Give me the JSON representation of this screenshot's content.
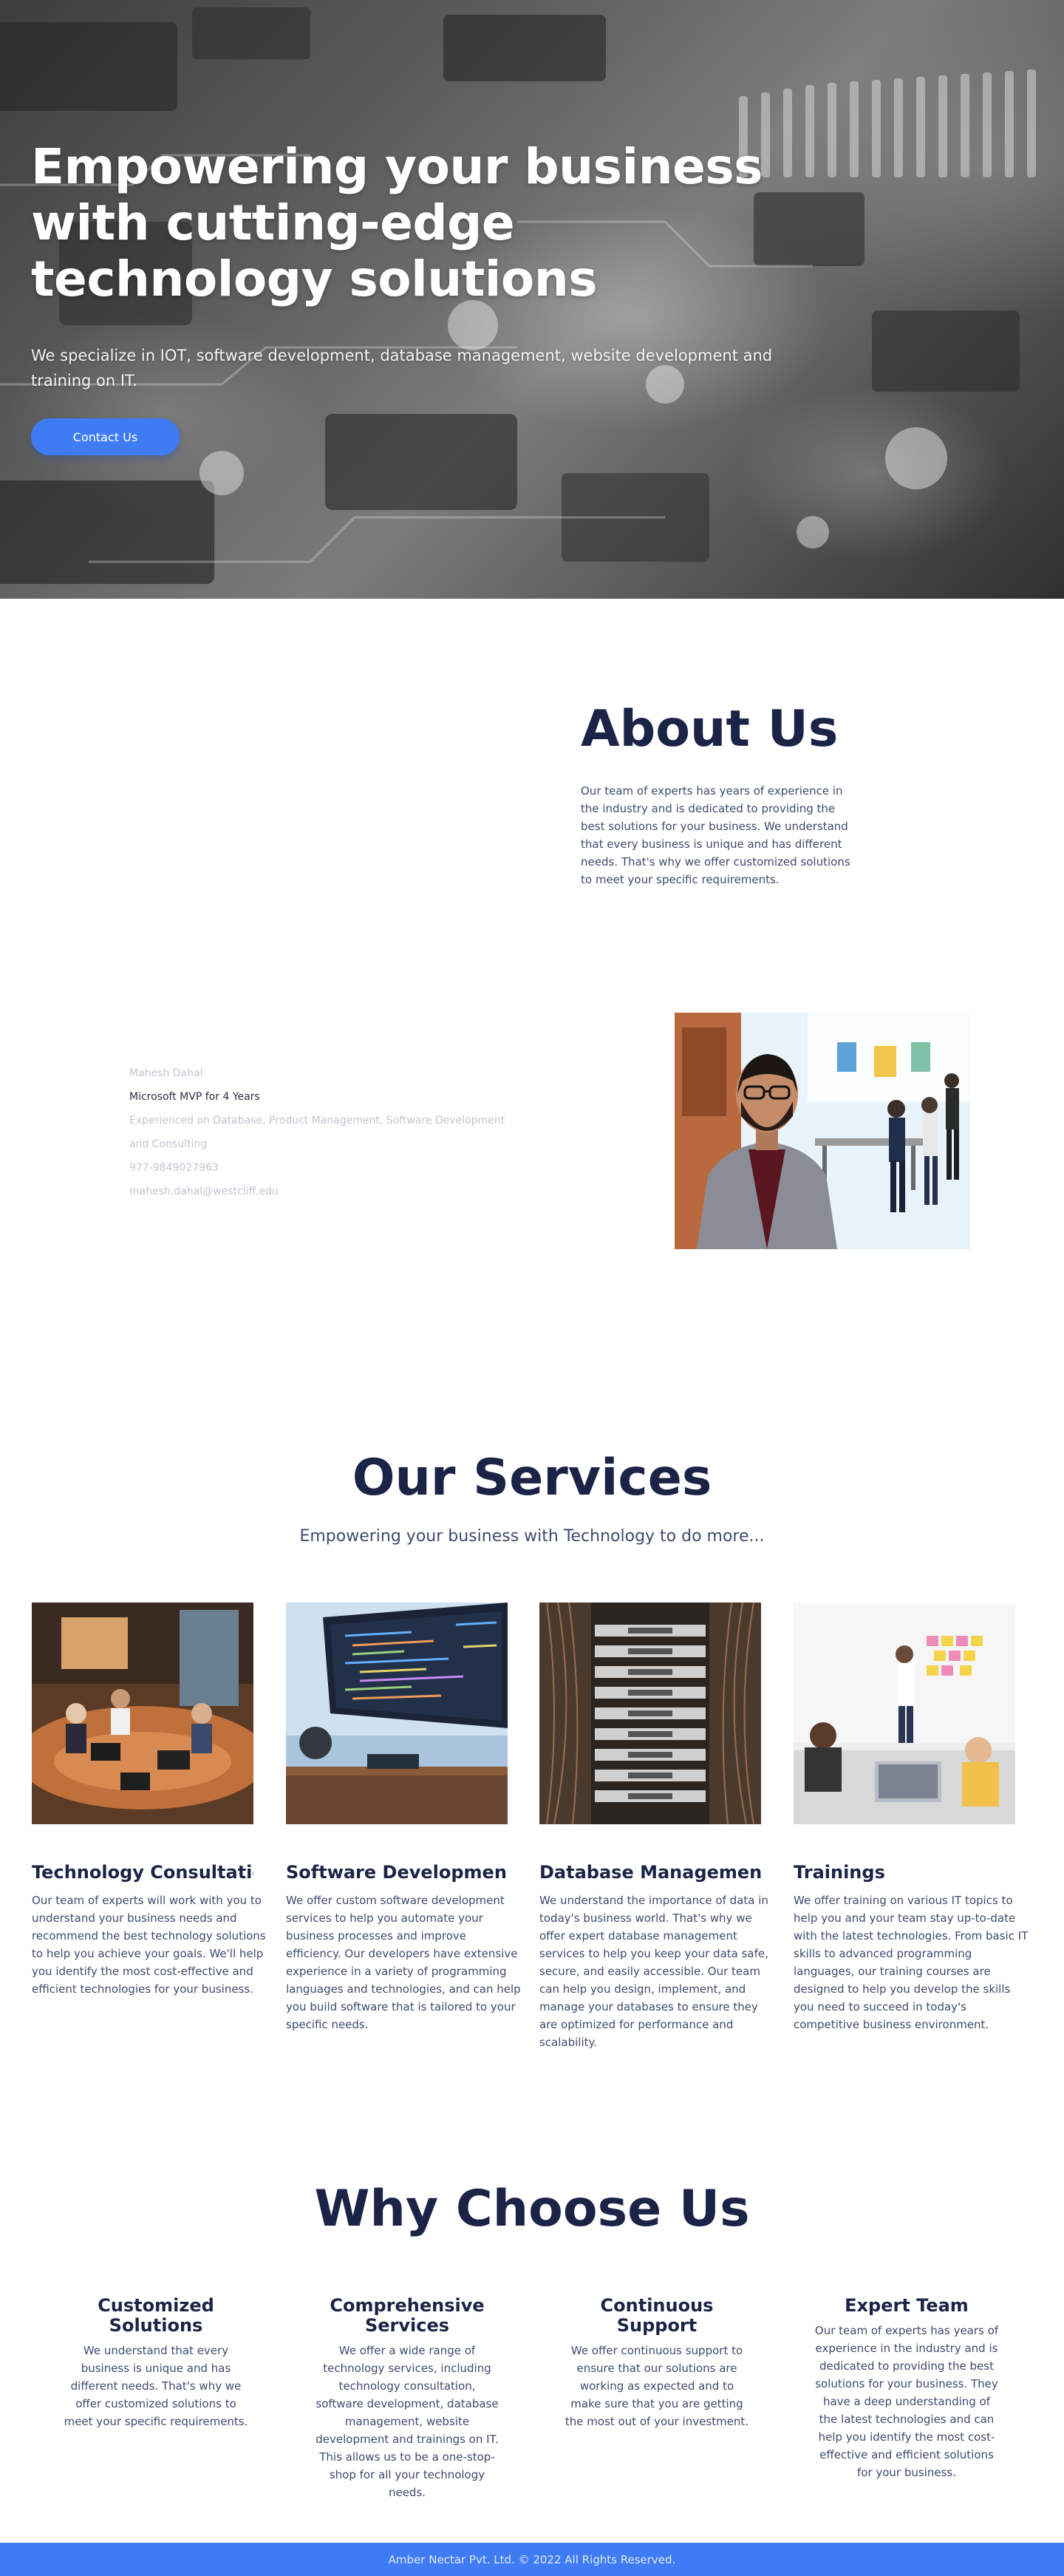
{
  "hero": {
    "title": "Empowering your business with cutting-edge technology solutions",
    "subtitle": "We specialize in IOT, software development, database management, website development and training on IT.",
    "cta_label": "Contact Us",
    "image": "circuit-board-background"
  },
  "about": {
    "title": "About Us",
    "text": "Our team of experts has years of experience in the industry and is dedicated to providing the best solutions for your business. We understand that every business is unique and has different needs. That's why we offer customized solutions to meet your specific requirements."
  },
  "profile": {
    "name": "Mahesh Dahal",
    "role": "Microsoft MVP for 4 Years",
    "experience": "Experienced on Database, Product Management, Software Development and Consulting",
    "phone": "977-9849027963",
    "email": "mahesh.dahal@westcliff.edu",
    "photo": "portrait-photo"
  },
  "services": {
    "title": "Our Services",
    "subtitle": "Empowering your business with Technology to do more...",
    "items": [
      {
        "title": "Technology Consultation:",
        "text": "Our team of experts will work with you to understand your business needs and recommend the best technology solutions to help you achieve your goals. We'll help you identify the most cost-effective and efficient technologies for your business.",
        "image": "meeting-photo"
      },
      {
        "title": "Software Developmen",
        "text": "We offer custom software development services to help you automate your business processes and improve efficiency. Our developers have extensive experience in a variety of programming languages and technologies, and can help you build software that is tailored to your specific needs.",
        "image": "code-monitor-photo"
      },
      {
        "title": "Database Management",
        "text": "We understand the importance of data in today's business world. That's why we offer expert database management services to help you keep your data safe, secure, and easily accessible. Our team can help you design, implement, and manage your databases to ensure they are optimized for performance and scalability.",
        "image": "server-rack-photo"
      },
      {
        "title": "Trainings",
        "text": "We offer training on various IT topics to help you and your team stay up-to-date with the latest technologies. From basic IT skills to advanced programming languages, our training courses are designed to help you develop the skills you need to succeed in today's competitive business environment.",
        "image": "training-session-photo"
      }
    ]
  },
  "why": {
    "title": "Why Choose Us",
    "items": [
      {
        "title": "Customized Solutions",
        "text": "We understand that every business is unique and has different needs. That's why we offer customized solutions to meet your specific requirements."
      },
      {
        "title": "Comprehensive Services",
        "text": "We offer a wide range of technology services, including technology consultation, software development, database management, website development and trainings on IT. This allows us to be a one-stop-shop for all your technology needs."
      },
      {
        "title": "Continuous Support",
        "text": "We offer continuous support to ensure that our solutions are working as expected and to make sure that you are getting the most out of your investment."
      },
      {
        "title": "Expert Team",
        "text": "Our team of experts has years of experience in the industry and is dedicated to providing the best solutions for your business. They have a deep understanding of the latest technologies and can help you identify the most cost-effective and efficient solutions for your business."
      }
    ]
  },
  "footer": {
    "text": "Amber Nectar Pvt. Ltd. © 2022 All Rights Reserved."
  },
  "colors": {
    "accent": "#3f7bf2",
    "heading": "#1b2347",
    "body_text": "#3f4a6e",
    "muted_text": "#c2c5cf"
  }
}
